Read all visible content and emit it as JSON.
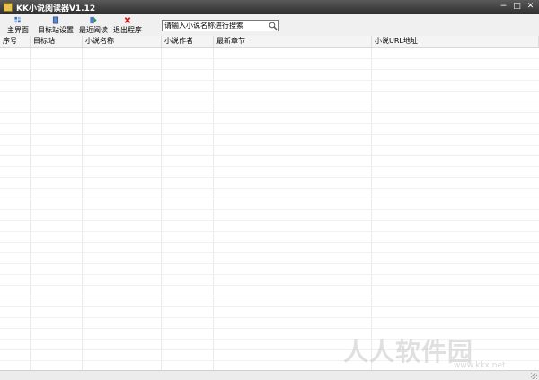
{
  "window": {
    "title": "KK小说阅读器V1.12",
    "minimize": "−",
    "maximize": "□",
    "close": "✕"
  },
  "toolbar": {
    "buttons": [
      {
        "label": "主界面",
        "icon": "home-icon"
      },
      {
        "label": "目标站设置",
        "icon": "settings-icon"
      },
      {
        "label": "最近阅读",
        "icon": "recent-read-icon"
      },
      {
        "label": "退出程序",
        "icon": "exit-icon"
      }
    ]
  },
  "search": {
    "placeholder": "请输入小说名称进行搜索",
    "icon": "search-icon"
  },
  "table": {
    "columns": [
      "序号",
      "目标站",
      "小说名称",
      "小说作者",
      "最新章节",
      "小说URL地址"
    ],
    "rows": []
  },
  "watermark": {
    "text": "人人软件园",
    "url": "www.kkx.net"
  },
  "colors": {
    "titlebar": "#3a3a3a",
    "toolbar": "#f0f0f0"
  }
}
